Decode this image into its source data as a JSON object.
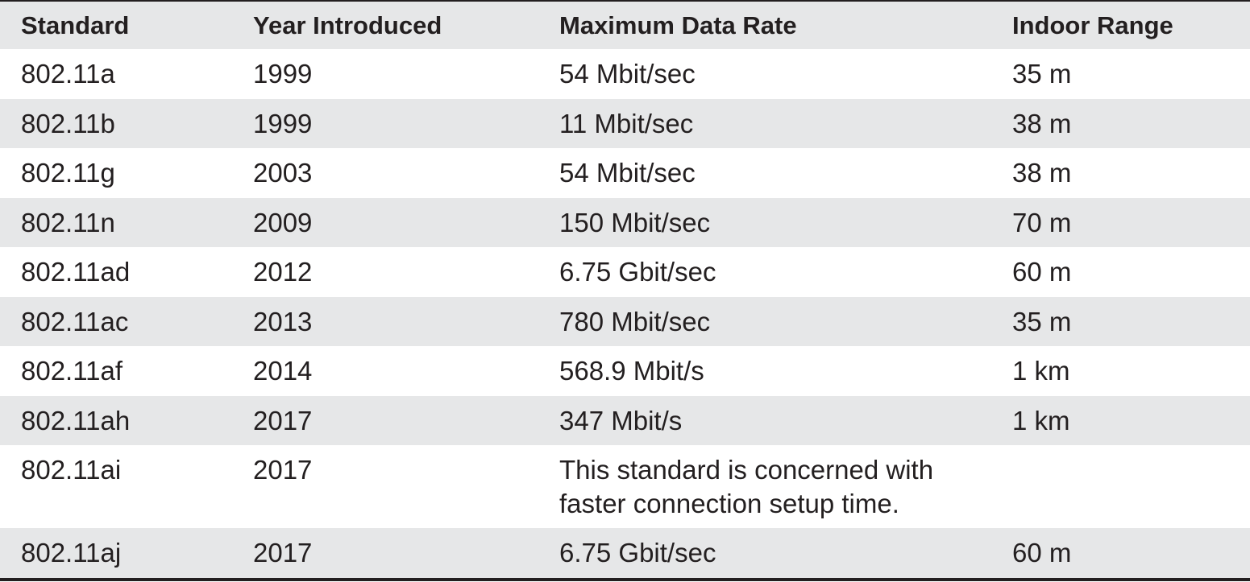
{
  "table": {
    "headers": [
      "Standard",
      "Year Introduced",
      "Maximum Data Rate",
      "Indoor Range"
    ],
    "rows": [
      [
        "802.11a",
        "1999",
        "54 Mbit/sec",
        "35 m"
      ],
      [
        "802.11b",
        "1999",
        "11 Mbit/sec",
        "38 m"
      ],
      [
        "802.11g",
        "2003",
        "54 Mbit/sec",
        "38 m"
      ],
      [
        "802.11n",
        "2009",
        "150 Mbit/sec",
        "70 m"
      ],
      [
        "802.11ad",
        "2012",
        "6.75 Gbit/sec",
        "60 m"
      ],
      [
        "802.11ac",
        "2013",
        "780 Mbit/sec",
        "35 m"
      ],
      [
        "802.11af",
        "2014",
        "568.9 Mbit/s",
        "1 km"
      ],
      [
        "802.11ah",
        "2017",
        "347 Mbit/s",
        "1 km"
      ],
      [
        "802.11ai",
        "2017",
        "This standard is concerned with faster connection setup time.",
        ""
      ],
      [
        "802.11aj",
        "2017",
        "6.75 Gbit/sec",
        "60 m"
      ]
    ]
  },
  "colors": {
    "shaded_row": "#e6e7e8",
    "text": "#231f20",
    "rule": "#231f20"
  }
}
